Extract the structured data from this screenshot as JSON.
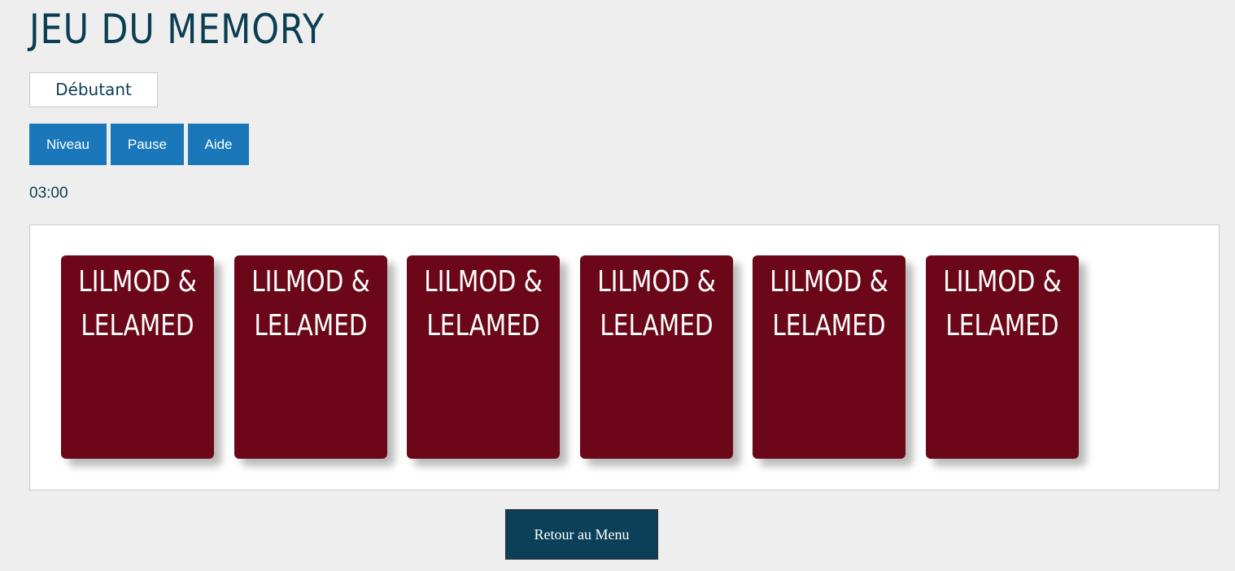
{
  "title": "JEU DU MEMORY",
  "level": "Débutant",
  "buttons": {
    "niveau": "Niveau",
    "pause": "Pause",
    "aide": "Aide"
  },
  "timer": "03:00",
  "cards": [
    {
      "label": "LILMOD &\nLELAMED"
    },
    {
      "label": "LILMOD &\nLELAMED"
    },
    {
      "label": "LILMOD &\nLELAMED"
    },
    {
      "label": "LILMOD &\nLELAMED"
    },
    {
      "label": "LILMOD &\nLELAMED"
    },
    {
      "label": "LILMOD &\nLELAMED"
    }
  ],
  "menu_button": "Retour au Menu",
  "colors": {
    "title": "#0b3e52",
    "button": "#1a78ba",
    "card_back": "#6b0719",
    "menu_button": "#0b4058"
  }
}
